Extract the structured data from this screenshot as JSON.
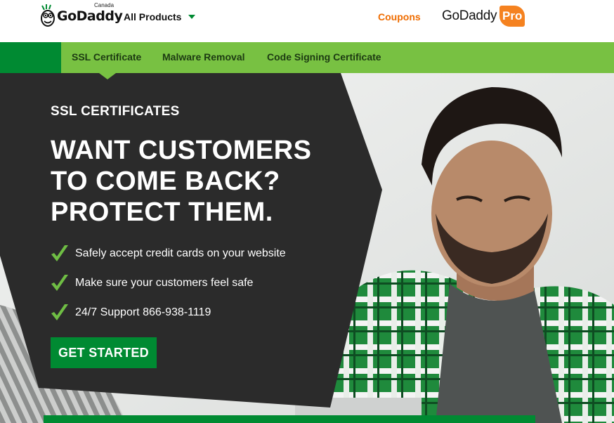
{
  "header": {
    "logo_text": "GoDaddy",
    "logo_region": "Canada",
    "all_products_label": "All Products",
    "coupons_label": "Coupons",
    "pro_logo_word": "GoDaddy",
    "pro_badge": "Pro"
  },
  "subnav": {
    "items": [
      {
        "label": "SSL Certificate",
        "active": true
      },
      {
        "label": "Malware Removal",
        "active": false
      },
      {
        "label": "Code Signing Certificate",
        "active": false
      }
    ]
  },
  "hero": {
    "eyebrow": "SSL CERTIFICATES",
    "headline_lines": [
      "WANT CUSTOMERS",
      "TO COME BACK?",
      "PROTECT THEM."
    ],
    "bullets": [
      "Safely accept credit cards on your website",
      "Make sure your customers feel safe",
      "24/7 Support 866-938-1119"
    ],
    "cta_label": "GET STARTED"
  },
  "colors": {
    "brand_green": "#008a32",
    "nav_green": "#78c142",
    "accent_orange": "#ef6c00",
    "panel": "#2b2b2b"
  }
}
